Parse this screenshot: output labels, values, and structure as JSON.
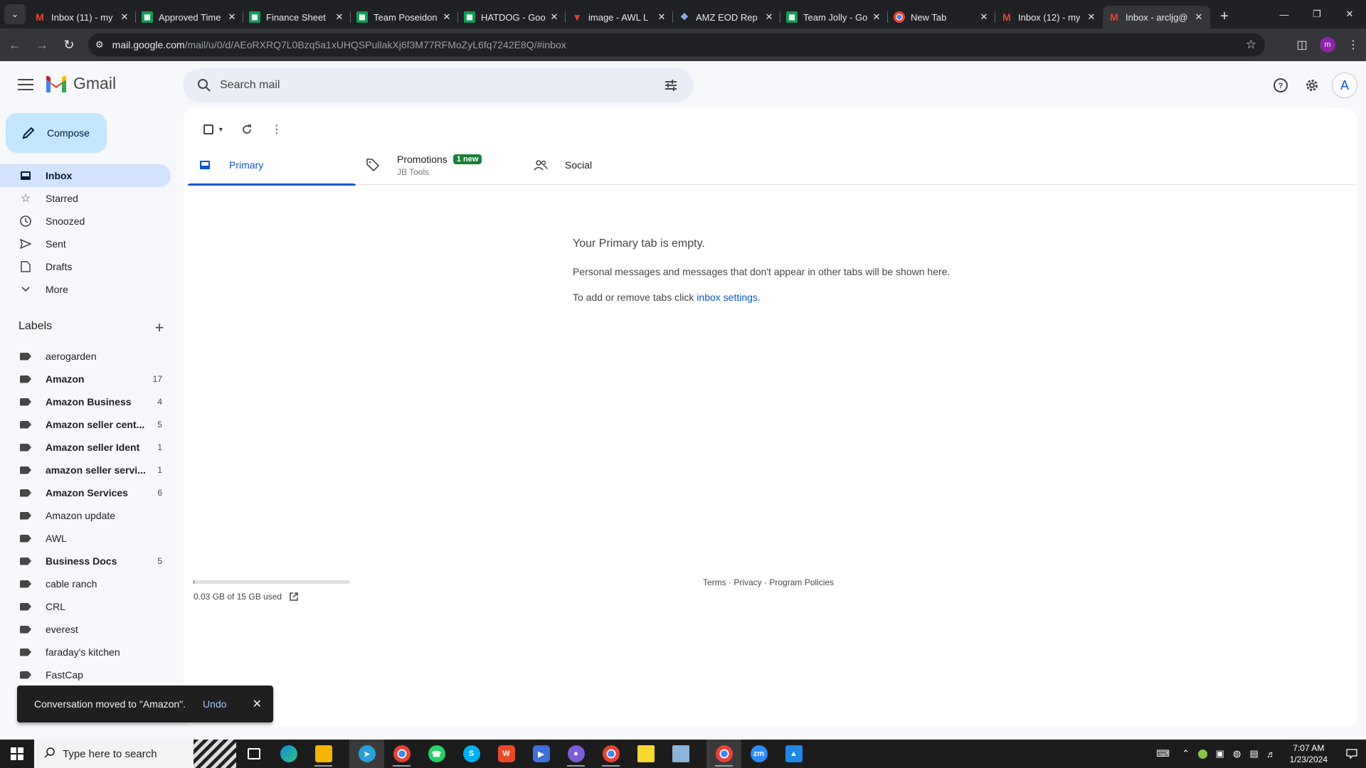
{
  "browser": {
    "tabs": [
      {
        "title": "Inbox (11) - my",
        "icon": "gmail-icon",
        "active": false
      },
      {
        "title": "Approved Time",
        "icon": "sheets-icon",
        "active": false
      },
      {
        "title": "Finance Sheet",
        "icon": "sheets-icon",
        "active": false
      },
      {
        "title": "Team Poseidon",
        "icon": "sheets-icon",
        "active": false
      },
      {
        "title": "HATDOG - Goo",
        "icon": "sheets-icon",
        "active": false
      },
      {
        "title": "image - AWL L",
        "icon": "red-logo-icon",
        "active": false
      },
      {
        "title": "AMZ EOD Rep",
        "icon": "amz-icon",
        "active": false
      },
      {
        "title": "Team Jolly - Go",
        "icon": "sheets-icon",
        "active": false
      },
      {
        "title": "New Tab",
        "icon": "chrome-icon",
        "active": false
      },
      {
        "title": "Inbox (12) - my",
        "icon": "gmail-icon",
        "active": false
      },
      {
        "title": "Inbox - arcljg@",
        "icon": "gmail-icon",
        "active": true
      }
    ],
    "url_host": "mail.google.com",
    "url_path": "/mail/u/0/d/AEoRXRQ7L0Bzq5a1xUHQSPullakXj6f3M77RFMoZyL6fq7242E8Q/#inbox",
    "profile_initial": "m"
  },
  "gmail": {
    "logo_text": "Gmail",
    "search_placeholder": "Search mail",
    "account_initial": "A",
    "compose_label": "Compose",
    "nav": [
      {
        "label": "Inbox",
        "icon": "inbox-icon",
        "active": true
      },
      {
        "label": "Starred",
        "icon": "star-icon",
        "active": false
      },
      {
        "label": "Snoozed",
        "icon": "clock-icon",
        "active": false
      },
      {
        "label": "Sent",
        "icon": "send-icon",
        "active": false
      },
      {
        "label": "Drafts",
        "icon": "draft-icon",
        "active": false
      },
      {
        "label": "More",
        "icon": "chevron-down-icon",
        "active": false
      }
    ],
    "labels_heading": "Labels",
    "labels": [
      {
        "name": "aerogarden",
        "count": "",
        "bold": false
      },
      {
        "name": "Amazon",
        "count": "17",
        "bold": true
      },
      {
        "name": "Amazon Business",
        "count": "4",
        "bold": true
      },
      {
        "name": "Amazon seller cent...",
        "count": "5",
        "bold": true
      },
      {
        "name": "Amazon seller Ident",
        "count": "1",
        "bold": true
      },
      {
        "name": "amazon seller servi...",
        "count": "1",
        "bold": true
      },
      {
        "name": "Amazon Services",
        "count": "6",
        "bold": true
      },
      {
        "name": "Amazon update",
        "count": "",
        "bold": false
      },
      {
        "name": "AWL",
        "count": "",
        "bold": false
      },
      {
        "name": "Business Docs",
        "count": "5",
        "bold": true
      },
      {
        "name": "cable ranch",
        "count": "",
        "bold": false
      },
      {
        "name": "CRL",
        "count": "",
        "bold": false
      },
      {
        "name": "everest",
        "count": "",
        "bold": false
      },
      {
        "name": "faraday's kitchen",
        "count": "",
        "bold": false
      },
      {
        "name": "FastCap",
        "count": "",
        "bold": false
      }
    ],
    "tabs": {
      "primary": "Primary",
      "promotions": "Promotions",
      "promotions_badge": "1 new",
      "promotions_sub": "JB Tools",
      "social": "Social"
    },
    "empty": {
      "title": "Your Primary tab is empty.",
      "line1": "Personal messages and messages that don't appear in other tabs will be shown here.",
      "line2_prefix": "To add or remove tabs click ",
      "line2_link": "inbox settings",
      "line2_suffix": "."
    },
    "storage": {
      "text": "0.03 GB of 15 GB used",
      "fraction": 0.002
    },
    "footer": {
      "terms": "Terms",
      "privacy": "Privacy",
      "policies": "Program Policies",
      "sep": " · "
    },
    "snackbar": {
      "message": "Conversation moved to \"Amazon\".",
      "undo": "Undo"
    }
  },
  "taskbar": {
    "search_placeholder": "Type here to search",
    "time": "7:07 AM",
    "date": "1/23/2024"
  },
  "colors": {
    "accent": "#0b57d0",
    "compose_bg": "#c2e7ff",
    "active_nav": "#d3e3fd",
    "badge": "#188038"
  }
}
